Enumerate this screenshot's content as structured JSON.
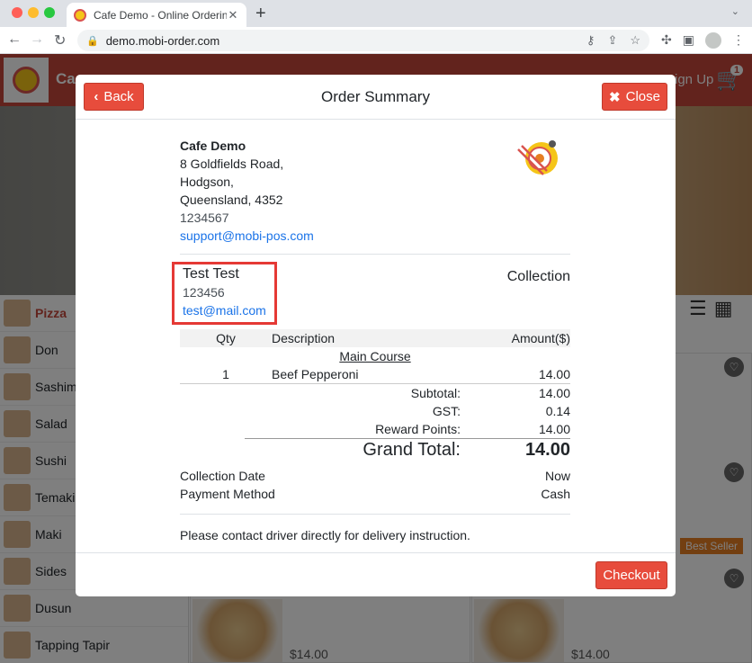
{
  "browser": {
    "tab_title": "Cafe Demo - Online Ordering",
    "url": "demo.mobi-order.com"
  },
  "site": {
    "brand": "Ca",
    "signup": "Sign Up",
    "cart_count": "1",
    "categories": [
      {
        "label": "Pizza",
        "active": true
      },
      {
        "label": "Don"
      },
      {
        "label": "Sashimi"
      },
      {
        "label": "Salad"
      },
      {
        "label": "Sushi"
      },
      {
        "label": "Temaki"
      },
      {
        "label": "Maki"
      },
      {
        "label": "Sides"
      },
      {
        "label": "Dusun"
      },
      {
        "label": "Tapping Tapir"
      }
    ],
    "best_seller": "Best Seller",
    "price_1": "$14.00",
    "price_2": "$14.00"
  },
  "modal": {
    "back_label": "Back",
    "title": "Order Summary",
    "close_label": "Close",
    "store": {
      "name": "Cafe Demo",
      "address1": "8 Goldfields Road,",
      "address2": "Hodgson,",
      "address3": "Queensland, 4352",
      "phone": "1234567",
      "email": "support@mobi-pos.com"
    },
    "customer": {
      "name": "Test Test",
      "phone": "123456",
      "email": "test@mail.com"
    },
    "order_type": "Collection",
    "table": {
      "headers": {
        "qty": "Qty",
        "desc": "Description",
        "amount": "Amount($)"
      },
      "group": "Main Course",
      "items": [
        {
          "qty": "1",
          "desc": "Beef Pepperoni",
          "amount": "14.00"
        }
      ]
    },
    "totals": {
      "subtotal_label": "Subtotal:",
      "subtotal": "14.00",
      "gst_label": "GST:",
      "gst": "0.14",
      "reward_label": "Reward Points:",
      "reward": "14.00",
      "grand_label": "Grand Total:",
      "grand": "14.00"
    },
    "meta": {
      "collection_date_label": "Collection Date",
      "collection_date": "Now",
      "payment_label": "Payment Method",
      "payment": "Cash"
    },
    "note": "Please contact driver directly for delivery instruction.",
    "checkout_label": "Checkout"
  },
  "colors": {
    "accent": "#e74c3c",
    "highlight_box": "#e53935",
    "link": "#1a73e8"
  }
}
